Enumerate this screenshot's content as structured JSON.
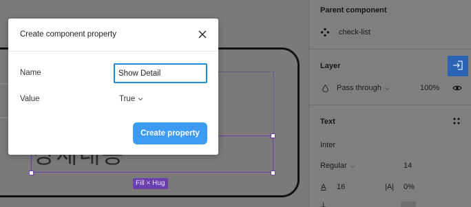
{
  "canvas": {
    "korean_text": "상세내용",
    "badge": "Fill × Hug"
  },
  "panel": {
    "parent_component_title": "Parent component",
    "parent_component_name": "check-list",
    "layer_title": "Layer",
    "blend_mode": "Pass through",
    "opacity": "100%",
    "text_title": "Text",
    "font_family": "Inter",
    "font_weight": "Regular",
    "font_size": "14",
    "line_height": "16",
    "letter_spacing": "0%"
  },
  "modal": {
    "title": "Create component property",
    "name_label": "Name",
    "name_value": "Show Detail",
    "value_label": "Value",
    "value_selected": "True",
    "create_button": "Create property"
  },
  "colors": {
    "accent_blue": "#3d9bf3",
    "selection_purple": "#6a3fb0"
  }
}
